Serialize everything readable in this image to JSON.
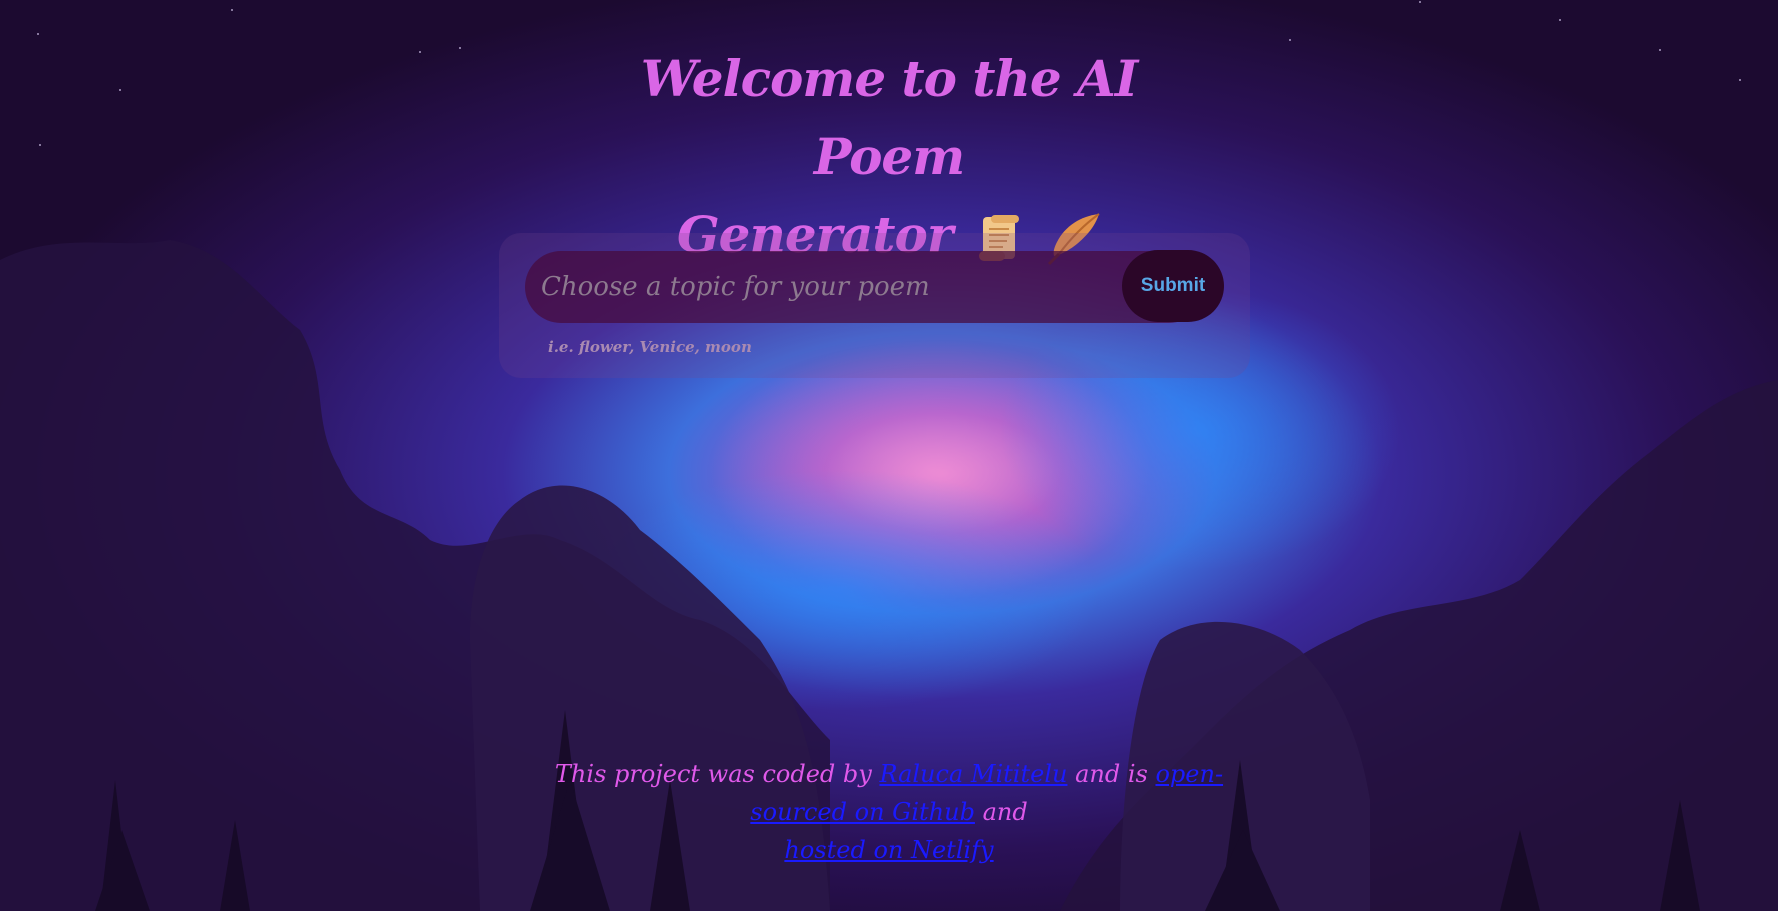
{
  "header": {
    "title_line1": "Welcome to the AI Poem",
    "title_line2": "Generator",
    "emojis": [
      "scroll-icon",
      "quill-icon"
    ]
  },
  "form": {
    "input_placeholder": "Choose a topic for your poem",
    "input_value": "",
    "submit_label": "Submit",
    "hint": "i.e. flower, Venice, moon"
  },
  "footer": {
    "text_before": "This project was coded by ",
    "author_link": "Raluca Mititelu",
    "text_middle": " and is ",
    "github_link": "open-sourced on Github",
    "text_after": " and ",
    "netlify_link": "hosted on Netlify"
  },
  "colors": {
    "title": "#d966e6",
    "footer_text": "#e059ea",
    "link": "#1a1aff",
    "submit_text": "#58a7e6",
    "submit_bg": "#2b0628",
    "input_bg": "#460a3c",
    "background": "#1e0b35"
  }
}
